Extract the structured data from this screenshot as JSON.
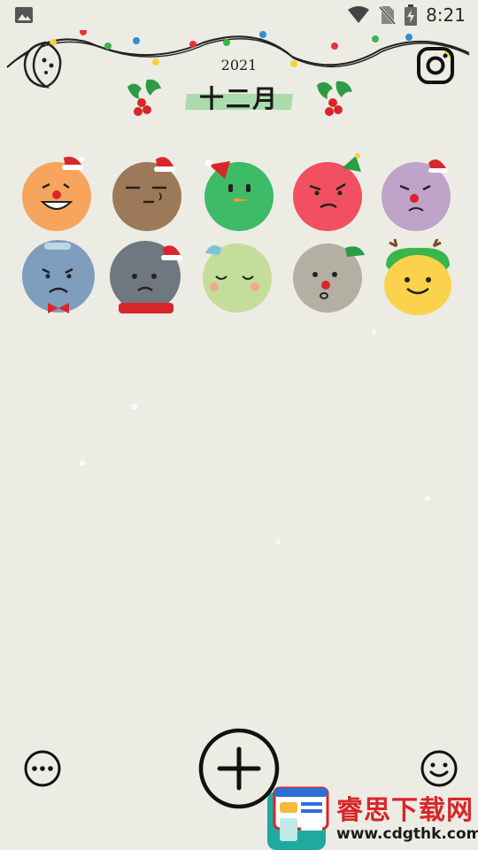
{
  "status_bar": {
    "time": "8:21",
    "icons": [
      "image-icon",
      "wifi-icon",
      "no-sim-icon",
      "battery-charging-icon"
    ]
  },
  "header": {
    "year": "2021",
    "month": "十二月",
    "left_button_icon": "moon-face-icon",
    "right_button_icon": "instagram-icon"
  },
  "mood_faces": [
    {
      "id": "orange-clown",
      "color": "#f7a55c"
    },
    {
      "id": "brown-santa",
      "color": "#9c7a59"
    },
    {
      "id": "green-snowman",
      "color": "#3dbb67"
    },
    {
      "id": "red-angry",
      "color": "#f0505f"
    },
    {
      "id": "purple-sad",
      "color": "#bfa3c9"
    },
    {
      "id": "blue-bowtie",
      "color": "#7f9dbd"
    },
    {
      "id": "gray-scarf",
      "color": "#6f7781"
    },
    {
      "id": "lime-sleepy",
      "color": "#c4dd9a"
    },
    {
      "id": "gray-reindeer-nose",
      "color": "#b3afa3"
    },
    {
      "id": "yellow-reindeer",
      "color": "#fbd24b"
    }
  ],
  "bottom_bar": {
    "menu_icon": "more-options-icon",
    "add_icon": "add-icon",
    "mood_icon": "smiley-icon"
  },
  "ad_banner": {
    "title": "睿思下载网",
    "url": "www.cdgthk.com"
  }
}
